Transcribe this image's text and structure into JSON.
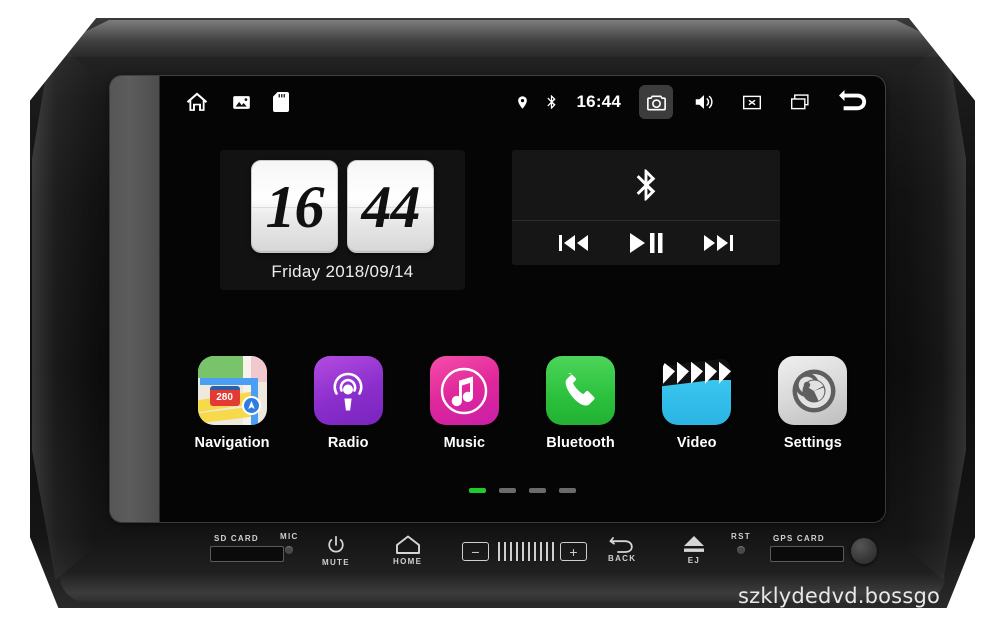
{
  "device": {
    "watermark": "szklydedvd.bossgo"
  },
  "statusbar": {
    "home_icon": "home-icon",
    "gallery_icon": "gallery-icon",
    "sdcard_icon": "sdcard-icon",
    "location_icon": "location-pin-icon",
    "bluetooth_icon": "bluetooth-icon",
    "time": "16:44",
    "camera_icon": "camera-icon",
    "volume_icon": "volume-icon",
    "close_icon": "close-box-icon",
    "recents_icon": "recents-icon",
    "back_icon": "back-arrow-icon"
  },
  "clock_widget": {
    "hours": "16",
    "minutes": "44",
    "date": "Friday  2018/09/14"
  },
  "media_widget": {
    "source_icon": "bluetooth-icon",
    "prev_label": "prev-track",
    "playpause_label": "play-pause",
    "next_label": "next-track"
  },
  "apps": [
    {
      "label": "Navigation",
      "icon": "maps-icon",
      "shield": "280"
    },
    {
      "label": "Radio",
      "icon": "podcast-icon"
    },
    {
      "label": "Music",
      "icon": "music-note-icon"
    },
    {
      "label": "Bluetooth",
      "icon": "phone-icon"
    },
    {
      "label": "Video",
      "icon": "clapperboard-icon"
    },
    {
      "label": "Settings",
      "icon": "gears-icon"
    }
  ],
  "pager": {
    "count": 4,
    "active_index": 0,
    "active_color": "#1ecb2a",
    "inactive_color": "#6b6b6b"
  },
  "hardware": {
    "sd_card_label": "SD CARD",
    "mic_label": "MIC",
    "mute_label": "MUTE",
    "home_label": "HOME",
    "back_label": "BACK",
    "eject_label": "EJ",
    "reset_label": "RST",
    "gps_card_label": "GPS CARD",
    "volume_down": "−",
    "volume_up": "+"
  }
}
